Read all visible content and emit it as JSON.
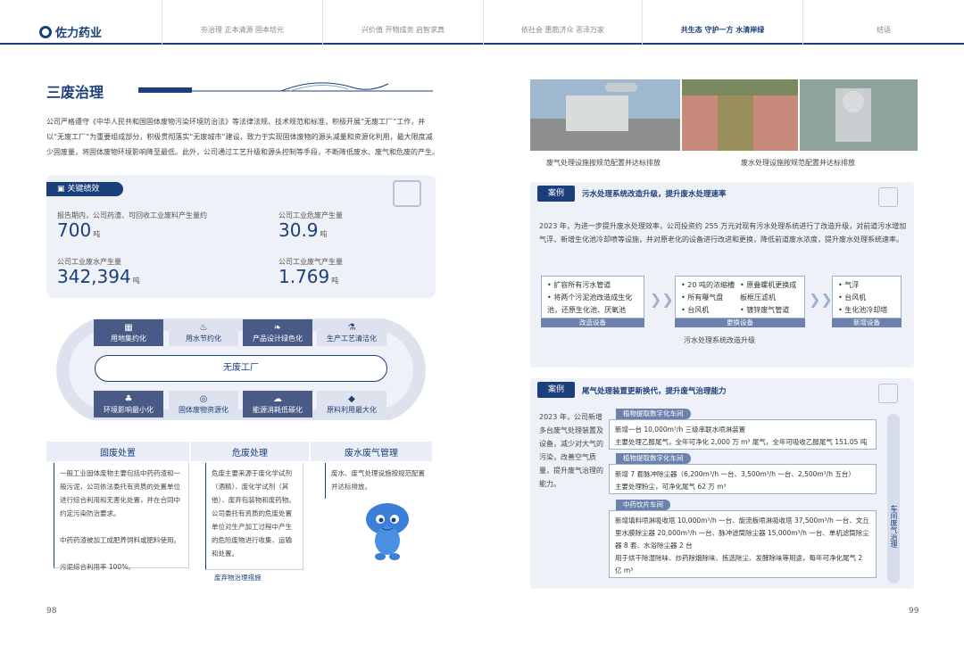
{
  "header": {
    "logo_text": "佐力药业",
    "nav": [
      {
        "label": "夯治理 正本清源 固本培元"
      },
      {
        "label": "兴价值 开物成务 启智求真"
      },
      {
        "label": "依社会 惠筋济众 恶泽万家"
      },
      {
        "label": "共生态 守护一方 水清岸绿"
      },
      {
        "label": "结语"
      }
    ]
  },
  "left": {
    "title": "三废治理",
    "intro": "公司严格遵守《中华人民共和国固体废物污染环境防治法》等法律法规、技术规范和标准，积极开展“无废工厂”工作，并以“无废工厂”为重要组成部分，积极贯彻落实“无废城市”建设，致力于实现固体废物的源头减量和资源化利用，最大限度减少固废量，将固体废物环境影响降至最低。此外，公司通过工艺升级和源头控制等手段，不断降低废水、废气和危废的产生。",
    "kpi_tag": "关键绩效",
    "kpis": [
      {
        "label": "报告期内，公司药渣、可回收工业废料产生量约",
        "value": "700",
        "unit": "吨"
      },
      {
        "label": "公司工业危废产生量",
        "value": "30.9",
        "unit": "吨"
      },
      {
        "label": "公司工业废水产生量",
        "value": "342,394",
        "unit": "吨"
      },
      {
        "label": "公司工业废气产生量",
        "value": "1.769",
        "unit": "吨"
      }
    ],
    "loop_center": "无废工厂",
    "loop_top": [
      "用地集约化",
      "用水节约化",
      "产品设计绿色化",
      "生产工艺清洁化"
    ],
    "loop_bottom": [
      "环境影响最小化",
      "固体废物资源化",
      "能源消耗低碳化",
      "原料利用最大化"
    ],
    "columns": [
      {
        "head": "固废处置",
        "body": "一般工业固体废物主要包括中药药渣和一般污泥，公司依法委托有资质的处置单位进行综合利用和无害化处置，并在合同中约定污染防治要求。\n\n中药药渣被加工成肥养饲料或肥料使用。\n\n污泥综合利用率 100%。"
      },
      {
        "head": "危废处理",
        "body": "危废主要来源于废化学试剂（酒精）、废化学试剂（其他）、废弃包装物和废药物。公司委托有资质的危废处置单位对生产加工过程中产生的危险废物进行收集、运输和处置。"
      },
      {
        "head": "废水废气管理",
        "body": "废水、废气处理设施按规范配置并达标排放。"
      }
    ],
    "footer_label": "废弃物治理措施",
    "page_number": "98"
  },
  "right": {
    "photo_captions": [
      "废气处理设施按规范配置并达标排放",
      "废水处理设施按规范配置并达标排放"
    ],
    "case1": {
      "tag": "案例",
      "title": "污水处理系统改造升级，提升废水处理速率",
      "text": "2023 年，为进一步提升废水处理效率，公司投资约 255 万元对现有污水处理系统进行了改造升级，对前道污水增加气浮、新增生化池冷却喷等设施，并对原老化的设备进行改进和更换，降低前道废水浓度，提升废水处理系统速率。",
      "steps": [
        {
          "label": "改造设备",
          "items": [
            "扩容所有污水管道",
            "将两个污泥池改造成生化池，还原生化池、厌氧池"
          ]
        },
        {
          "label": "更换设备",
          "items": [
            "20 吨的浓缩槽",
            "原叠螺机更换成",
            "所有曝气盘",
            "板框压滤机",
            "台风机",
            "镀锌废气管道"
          ]
        },
        {
          "label": "新增设备",
          "items": [
            "气浮",
            "台风机",
            "生化池冷却塔"
          ]
        }
      ],
      "caption": "污水处理系统改造升级"
    },
    "case2": {
      "tag": "案例",
      "title": "尾气处理装置更新换代，提升废气治理能力",
      "text": "2023 年，公司新增多台废气处理装置及设备，减少对大气的污染，改善空气质量，提升废气治理的能力。",
      "units": [
        {
          "tag": "植物提取数字化车间",
          "body": "新增一台 10,000m³/h 三级串联水喷淋装置\n主要处理乙醇尾气，全年可净化 2,000 万 m³ 尾气，全年可吸收乙醇尾气 151.05 吨"
        },
        {
          "tag": "植物提取数字化车间",
          "body": "新增 7 套脉冲除尘器（6,200m³/h 一台、3,500m³/h 一台、2,500m³/h 五台）\n主要处理粉尘，可净化尾气 62 万 m³"
        },
        {
          "tag": "中药饮片车间",
          "body": "新增填料喷淋吸收塔 10,000m³/h 一台、旋流板喷淋吸收塔 37,500m³/h 一台、文丘里水膜除尘器 20,000m³/h 一台、脉冲滤筒除尘器 15,000m³/h 一台、单机滤筒除尘器 8 套、水浴除尘器 2 台\n用于烘干除湿除味、炒药除烟除味、拣选除尘、发酵除味等用途，每年可净化尾气 2 亿 m³"
        }
      ],
      "side_label": "车间废气治理"
    },
    "page_number": "99"
  }
}
